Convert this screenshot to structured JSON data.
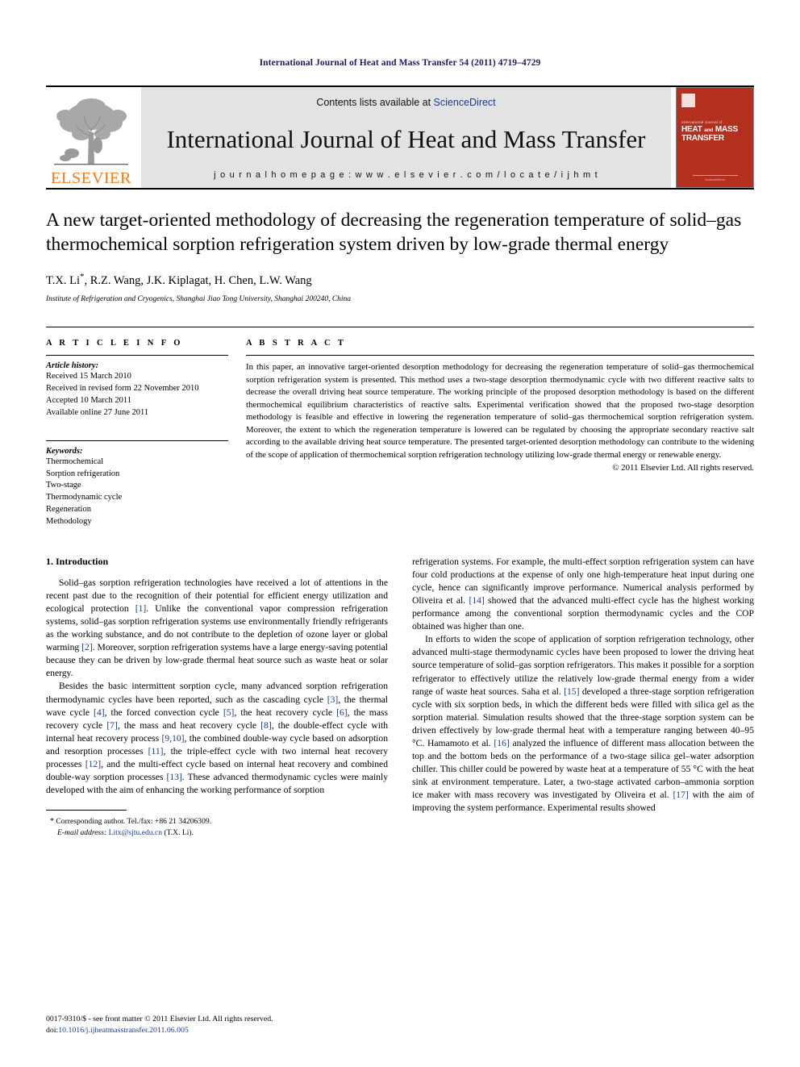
{
  "running_head": "International Journal of Heat and Mass Transfer 54 (2011) 4719–4729",
  "masthead": {
    "publisher_name": "ELSEVIER",
    "contents_prefix": "Contents lists available at ",
    "contents_link": "ScienceDirect",
    "journal_title": "International Journal of Heat and Mass Transfer",
    "homepage": "j o u r n a l   h o m e p a g e :   w w w . e l s e v i e r . c o m / l o c a t e / i j h m t",
    "cover": {
      "overline": "International Journal of",
      "line1_a": "HEAT",
      "line1_b": "and",
      "line1_c": "MASS",
      "line2": "TRANSFER",
      "footer": "ScienceDirect",
      "color": "#b3301e"
    },
    "accent_orange": "#f47c20",
    "link_blue": "#1d3b8b"
  },
  "article": {
    "title": "A new target-oriented methodology of decreasing the regeneration temperature of solid–gas thermochemical sorption refrigeration system driven by low-grade thermal energy",
    "authors": "T.X. Li",
    "authors_rest": ", R.Z. Wang, J.K. Kiplagat, H. Chen, L.W. Wang",
    "author_star": "*",
    "affiliation": "Institute of Refrigeration and Cryogenics, Shanghai Jiao Tong University, Shanghai 200240, China"
  },
  "article_info": {
    "heading": "A R T I C L E   I N F O",
    "history_label": "Article history:",
    "history": [
      "Received 15 March 2010",
      "Received in revised form 22 November 2010",
      "Accepted 10 March 2011",
      "Available online 27 June 2011"
    ],
    "keywords_label": "Keywords:",
    "keywords": [
      "Thermochemical",
      "Sorption refrigeration",
      "Two-stage",
      "Thermodynamic cycle",
      "Regeneration",
      "Methodology"
    ]
  },
  "abstract": {
    "heading": "A B S T R A C T",
    "text": "In this paper, an innovative target-oriented desorption methodology for decreasing the regeneration temperature of solid–gas thermochemical sorption refrigeration system is presented. This method uses a two-stage desorption thermodynamic cycle with two different reactive salts to decrease the overall driving heat source temperature. The working principle of the proposed desorption methodology is based on the different thermochemical equilibrium characteristics of reactive salts. Experimental verification showed that the proposed two-stage desorption methodology is feasible and effective in lowering the regeneration temperature of solid–gas thermochemical sorption refrigeration system. Moreover, the extent to which the regeneration temperature is lowered can be regulated by choosing the appropriate secondary reactive salt according to the available driving heat source temperature. The presented target-oriented desorption methodology can contribute to the widening of the scope of application of thermochemical sorption refrigeration technology utilizing low-grade thermal energy or renewable energy.",
    "copyright": "© 2011 Elsevier Ltd. All rights reserved."
  },
  "body": {
    "section_title": "1. Introduction",
    "left_p1_a": "Solid–gas sorption refrigeration technologies have received a lot of attentions in the recent past due to the recognition of their potential for efficient energy utilization and ecological protection ",
    "left_p1_r1": "[1]",
    "left_p1_b": ". Unlike the conventional vapor compression refrigeration systems, solid–gas sorption refrigeration systems use environmentally friendly refrigerants as the working substance, and do not contribute to the depletion of ozone layer or global warming ",
    "left_p1_r2": "[2]",
    "left_p1_c": ". Moreover, sorption refrigeration systems have a large energy-saving potential because they can be driven by low-grade thermal heat source such as waste heat or solar energy.",
    "left_p2_a": "Besides the basic intermittent sorption cycle, many advanced sorption refrigeration thermodynamic cycles have been reported, such as the cascading cycle ",
    "left_p2_r3": "[3]",
    "left_p2_b": ", the thermal wave cycle ",
    "left_p2_r4": "[4]",
    "left_p2_c": ", the forced convection cycle ",
    "left_p2_r5": "[5]",
    "left_p2_d": ", the heat recovery cycle ",
    "left_p2_r6": "[6]",
    "left_p2_e": ", the mass recovery cycle ",
    "left_p2_r7": "[7]",
    "left_p2_f": ", the mass and heat recovery cycle ",
    "left_p2_r8": "[8]",
    "left_p2_g": ", the double-effect cycle with internal heat recovery process ",
    "left_p2_r910": "[9,10]",
    "left_p2_h": ", the combined double-way cycle based on adsorption and resorption processes ",
    "left_p2_r11": "[11]",
    "left_p2_i": ", the triple-effect cycle with two internal heat recovery processes ",
    "left_p2_r12": "[12]",
    "left_p2_j": ", and the multi-effect cycle based on internal heat recovery and combined double-way sorption processes ",
    "left_p2_r13": "[13]",
    "left_p2_k": ". These advanced thermodynamic cycles were mainly developed with the aim of enhancing the working performance of sorption",
    "right_p1_a": "refrigeration systems. For example, the multi-effect sorption refrigeration system can have four cold productions at the expense of only one high-temperature heat input during one cycle, hence can significantly improve performance. Numerical analysis performed by Oliveira et al. ",
    "right_p1_r14": "[14]",
    "right_p1_b": " showed that the advanced multi-effect cycle has the highest working performance among the conventional sorption thermodynamic cycles and the COP obtained was higher than one.",
    "right_p2_a": "In efforts to widen the scope of application of sorption refrigeration technology, other advanced multi-stage thermodynamic cycles have been proposed to lower the driving heat source temperature of solid–gas sorption refrigerators. This makes it possible for a sorption refrigerator to effectively utilize the relatively low-grade thermal energy from a wider range of waste heat sources. Saha et al. ",
    "right_p2_r15": "[15]",
    "right_p2_b": " developed a three-stage sorption refrigeration cycle with six sorption beds, in which the different beds were filled with silica gel as the sorption material. Simulation results showed that the three-stage sorption system can be driven effectively by low-grade thermal heat with a temperature ranging between 40–95 °C. Hamamoto et al. ",
    "right_p2_r16": "[16]",
    "right_p2_c": " analyzed the influence of different mass allocation between the top and the bottom beds on the performance of a two-stage silica gel–water adsorption chiller. This chiller could be powered by waste heat at a temperature of 55 °C with the heat sink at environment temperature. Later, a two-stage activated carbon–ammonia sorption ice maker with mass recovery was investigated by Oliveira et al. ",
    "right_p2_r17": "[17]",
    "right_p2_d": " with the aim of improving the system performance. Experimental results showed"
  },
  "footnote": {
    "star": "*",
    "corresponding": "Corresponding author. Tel./fax: +86 21 34206309.",
    "email_label": "E-mail address:",
    "email": "Litx@sjtu.edu.cn",
    "email_suffix": "(T.X. Li)."
  },
  "page_footer": {
    "line1": "0017-9310/$ - see front matter © 2011 Elsevier Ltd. All rights reserved.",
    "doi_prefix": "doi:",
    "doi": "10.1016/j.ijheatmasstransfer.2011.06.005"
  }
}
